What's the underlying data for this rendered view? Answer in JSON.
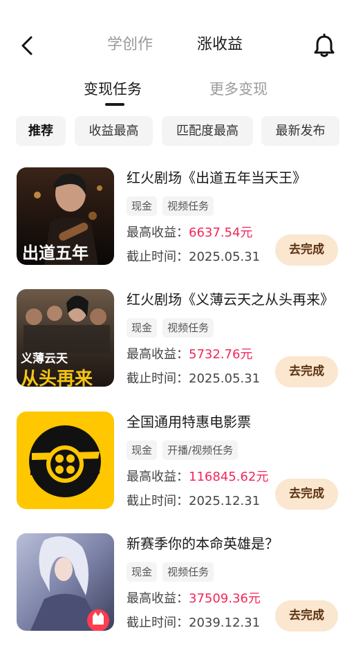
{
  "header": {
    "tabs": [
      {
        "label": "学创作"
      },
      {
        "label": "涨收益"
      }
    ]
  },
  "subtabs": [
    {
      "label": "变现任务"
    },
    {
      "label": "更多变现"
    }
  ],
  "filters": [
    {
      "label": "推荐"
    },
    {
      "label": "收益最高"
    },
    {
      "label": "匹配度最高"
    },
    {
      "label": "最新发布"
    }
  ],
  "tasks": [
    {
      "title": "红火剧场《出道五年当天王》",
      "tags": [
        "现金",
        "视频任务"
      ],
      "income_label": "最高收益：",
      "income_value": "6637.54元",
      "deadline": "截止时间：2025.05.31",
      "button": "去完成",
      "thumb_text": "出道五年"
    },
    {
      "title": "红火剧场《义薄云天之从头再来》",
      "tags": [
        "现金",
        "视频任务"
      ],
      "income_label": "最高收益：",
      "income_value": "5732.76元",
      "deadline": "截止时间：2025.05.31",
      "button": "去完成",
      "thumb_text": "义薄云天",
      "thumb_text2": "从头再来"
    },
    {
      "title": "全国通用特惠电影票",
      "tags": [
        "现金",
        "开播/视频任务"
      ],
      "income_label": "最高收益：",
      "income_value": "116845.62元",
      "deadline": "截止时间：2025.12.31",
      "button": "去完成"
    },
    {
      "title": "新赛季你的本命英雄是？",
      "tags": [
        "现金",
        "视频任务"
      ],
      "income_label": "最高收益：",
      "income_value": "37509.36元",
      "deadline": "截止时间：2039.12.31",
      "button": "去完成"
    }
  ],
  "colors": {
    "accent_value": "#f0285a",
    "button_bg": "#fbe6cf",
    "button_text": "#5c3313",
    "movie_bg": "#ffc700"
  },
  "icons": [
    "back-arrow-icon",
    "bell-icon",
    "film-reel-icon",
    "kuaishou-logo-icon"
  ]
}
